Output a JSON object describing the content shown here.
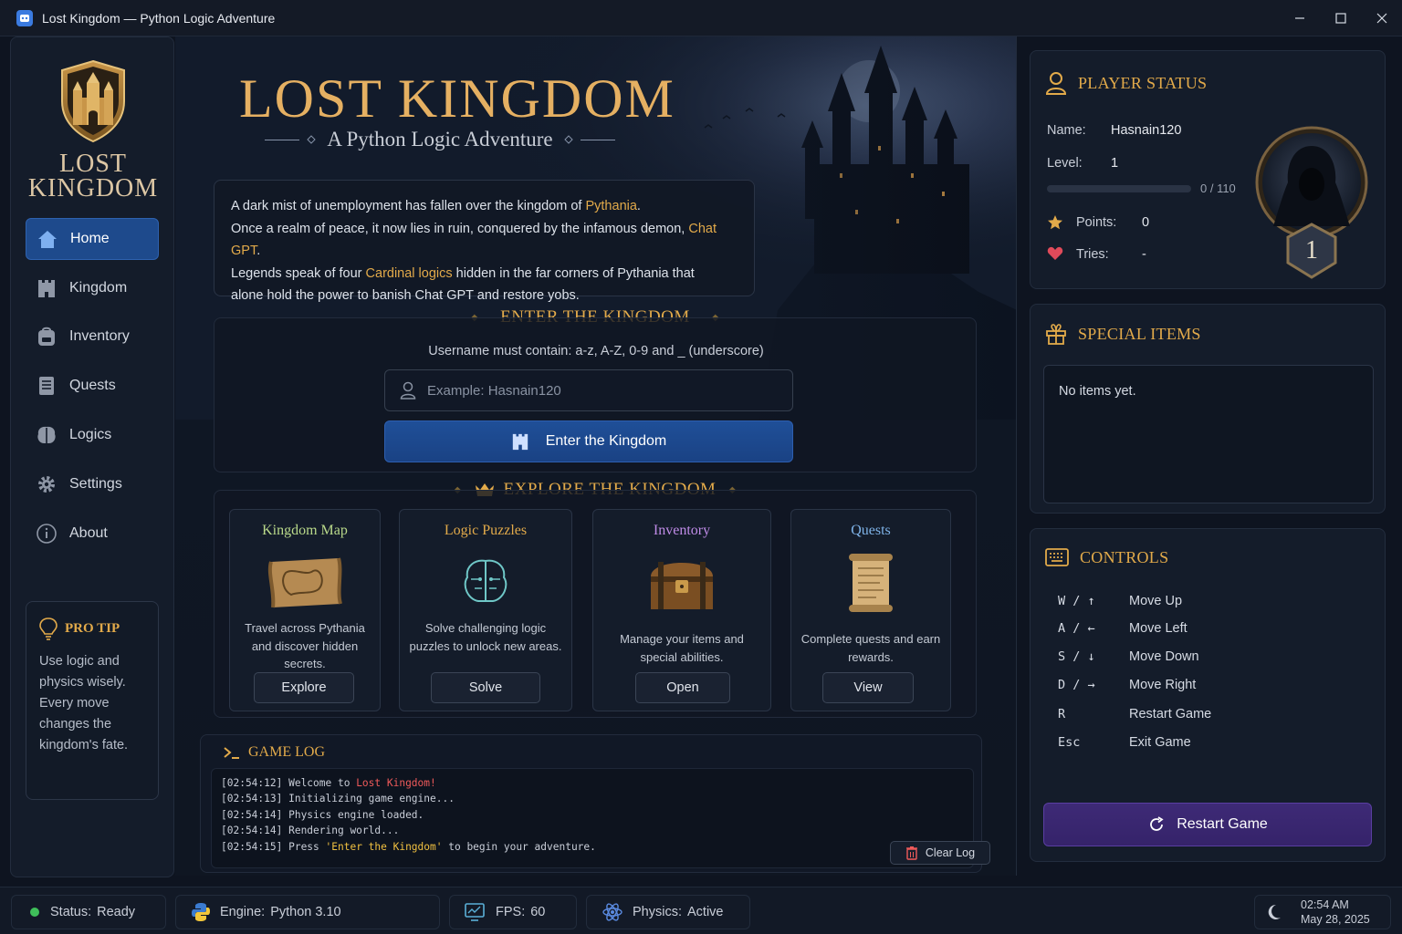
{
  "window": {
    "title": "Lost Kingdom — Python Logic Adventure"
  },
  "sidebar": {
    "logo_line1": "LOST",
    "logo_line2": "KINGDOM",
    "items": [
      {
        "label": "Home",
        "icon": "home-icon"
      },
      {
        "label": "Kingdom",
        "icon": "castle-icon"
      },
      {
        "label": "Inventory",
        "icon": "backpack-icon"
      },
      {
        "label": "Quests",
        "icon": "scroll-icon"
      },
      {
        "label": "Logics",
        "icon": "brain-icon"
      },
      {
        "label": "Settings",
        "icon": "gear-icon"
      },
      {
        "label": "About",
        "icon": "info-icon"
      }
    ],
    "active_item": "Home",
    "pro_tip": {
      "title": "PRO TIP",
      "text": "Use logic and physics wisely. Every move changes the kingdom's fate."
    }
  },
  "hero": {
    "title": "LOST KINGDOM",
    "subtitle": "A Python Logic Adventure"
  },
  "story": {
    "line1_a": "A dark mist of unemployment has fallen over the kingdom of ",
    "line1_hl": "Pythania",
    "line1_b": ".",
    "line2_a": "Once a realm of peace, it now lies in ruin, conquered by the infamous demon, ",
    "line2_hl": "Chat GPT",
    "line2_b": ".",
    "line3_a": "Legends speak of four ",
    "line3_hl": "Cardinal logics",
    "line3_b": " hidden in the far corners of Pythania that",
    "line4": "alone hold the power to banish Chat GPT and restore yobs."
  },
  "enter": {
    "heading": "ENTER THE KINGDOM",
    "note": "Username must contain: a-z, A-Z, 0-9 and _ (underscore)",
    "placeholder": "Example: Hasnain120",
    "value": "",
    "button": "Enter the Kingdom"
  },
  "explore": {
    "heading": "EXPLORE THE KINGDOM",
    "cards": [
      {
        "title": "Kingdom Map",
        "desc": "Travel across Pythania and discover hidden secrets.",
        "button": "Explore",
        "color": "#b9d98a"
      },
      {
        "title": "Logic Puzzles",
        "desc": "Solve challenging logic puzzles to unlock new areas.",
        "button": "Solve",
        "color": "#e2aa4a"
      },
      {
        "title": "Inventory",
        "desc": "Manage your items and special abilities.",
        "button": "Open",
        "color": "#c08ce8"
      },
      {
        "title": "Quests",
        "desc": "Complete quests and earn rewards.",
        "button": "View",
        "color": "#7fb3e8"
      }
    ]
  },
  "game_log": {
    "heading": "GAME LOG",
    "lines": [
      {
        "ts": "[02:54:12]",
        "text": " Welcome to ",
        "hl": "Lost Kingdom!",
        "hl_class": "log-red",
        "tail": ""
      },
      {
        "ts": "[02:54:13]",
        "text": " Initializing game engine...",
        "hl": "",
        "hl_class": "",
        "tail": ""
      },
      {
        "ts": "[02:54:14]",
        "text": " Physics engine loaded.",
        "hl": "",
        "hl_class": "",
        "tail": ""
      },
      {
        "ts": "[02:54:14]",
        "text": " Rendering world...",
        "hl": "",
        "hl_class": "",
        "tail": ""
      },
      {
        "ts": "[02:54:15]",
        "text": " Press ",
        "hl": "'Enter the Kingdom'",
        "hl_class": "log-yel",
        "tail": " to begin your adventure."
      }
    ],
    "clear_button": "Clear Log"
  },
  "player_status": {
    "heading": "PLAYER STATUS",
    "name_label": "Name:",
    "name": "Hasnain120",
    "level_label": "Level:",
    "level": "1",
    "xp_text": "0 / 110",
    "xp_fraction": 0.0,
    "points_label": "Points:",
    "points": "0",
    "tries_label": "Tries:",
    "tries": "-",
    "badge_level": "1"
  },
  "special_items": {
    "heading": "SPECIAL ITEMS",
    "empty_text": "No items yet."
  },
  "controls": {
    "heading": "CONTROLS",
    "rows": [
      {
        "key": "W / ↑",
        "action": "Move Up"
      },
      {
        "key": "A / ←",
        "action": "Move Left"
      },
      {
        "key": "S / ↓",
        "action": "Move Down"
      },
      {
        "key": "D / →",
        "action": "Move Right"
      },
      {
        "key": "R",
        "action": "Restart Game"
      },
      {
        "key": "Esc",
        "action": "Exit Game"
      }
    ],
    "restart_button": "Restart Game"
  },
  "statusbar": {
    "status_label": "Status:",
    "status_value": "Ready",
    "engine_label": "Engine:",
    "engine_value": "Python 3.10",
    "fps_label": "FPS:",
    "fps_value": "60",
    "physics_label": "Physics:",
    "physics_value": "Active",
    "time": "02:54 AM",
    "date": "May 28, 2025"
  },
  "colors": {
    "gold": "#e2aa4a",
    "active_nav": "#1e4a8c",
    "restart": "#3e2a76",
    "status_green": "#3fbf5a"
  }
}
